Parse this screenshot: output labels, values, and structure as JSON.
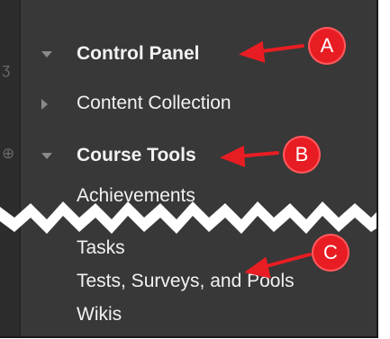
{
  "nav": {
    "control_panel": "Control Panel",
    "content_collection": "Content Collection",
    "course_tools": "Course Tools",
    "achievements": "Achievements",
    "tasks": "Tasks",
    "tests_surveys_pools": "Tests, Surveys, and Pools",
    "wikis": "Wikis"
  },
  "callouts": {
    "a": "A",
    "b": "B",
    "c": "C"
  },
  "icons": {
    "strip_icon_1": "unknown-icon",
    "strip_icon_2": "globe-icon"
  },
  "colors": {
    "panel_bg": "#383838",
    "marker": "#e81d23"
  }
}
